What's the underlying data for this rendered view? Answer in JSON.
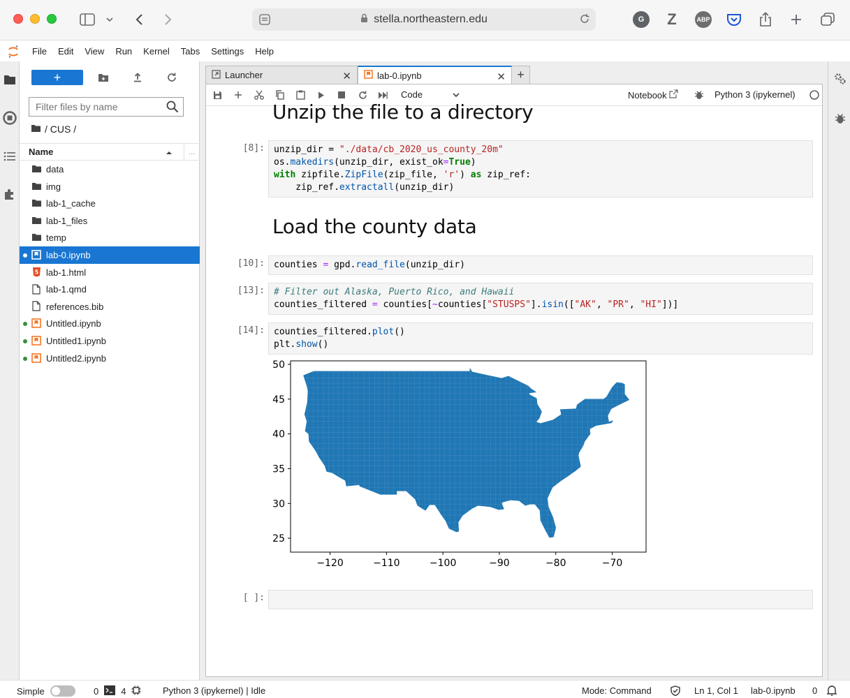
{
  "browser": {
    "url": "stella.northeastern.edu",
    "ext_abp": "ABP"
  },
  "menu": [
    "File",
    "Edit",
    "View",
    "Run",
    "Kernel",
    "Tabs",
    "Settings",
    "Help"
  ],
  "filebrowser": {
    "new_label": "+",
    "filter_placeholder": "Filter files by name",
    "breadcrumb": "/ CUS /",
    "header_name": "Name",
    "header_more": "...",
    "files": [
      {
        "name": "data",
        "type": "folder",
        "dot": ""
      },
      {
        "name": "img",
        "type": "folder",
        "dot": ""
      },
      {
        "name": "lab-1_cache",
        "type": "folder",
        "dot": ""
      },
      {
        "name": "lab-1_files",
        "type": "folder",
        "dot": ""
      },
      {
        "name": "temp",
        "type": "folder",
        "dot": ""
      },
      {
        "name": "lab-0.ipynb",
        "type": "notebook",
        "dot": "white",
        "selected": true
      },
      {
        "name": "lab-1.html",
        "type": "html",
        "dot": ""
      },
      {
        "name": "lab-1.qmd",
        "type": "file",
        "dot": ""
      },
      {
        "name": "references.bib",
        "type": "file",
        "dot": ""
      },
      {
        "name": "Untitled.ipynb",
        "type": "notebook",
        "dot": "green"
      },
      {
        "name": "Untitled1.ipynb",
        "type": "notebook",
        "dot": "green"
      },
      {
        "name": "Untitled2.ipynb",
        "type": "notebook",
        "dot": "green"
      }
    ]
  },
  "tabs": [
    {
      "label": "Launcher",
      "current": false
    },
    {
      "label": "lab-0.ipynb",
      "current": true
    }
  ],
  "toolbar": {
    "cell_type": "Code",
    "notebook_label": "Notebook",
    "kernel": "Python 3 (ipykernel)"
  },
  "notebook": {
    "heading1": "Unzip the file to a directory",
    "heading2": "Load the county data",
    "prompt_8": "[8]:",
    "prompt_10": "[10]:",
    "prompt_13": "[13]:",
    "prompt_14": "[14]:",
    "prompt_empty": "[ ]:",
    "code_8": [
      "unzip_dir = \"./data/cb_2020_us_county_20m\"",
      "os.makedirs(unzip_dir, exist_ok=True)",
      "with zipfile.ZipFile(zip_file, 'r') as zip_ref:",
      "    zip_ref.extractall(unzip_dir)"
    ],
    "code_10": "counties = gpd.read_file(unzip_dir)",
    "code_13": [
      "# Filter out Alaska, Puerto Rico, and Hawaii",
      "counties_filtered = counties[~counties[\"STUSPS\"].isin([\"AK\", \"PR\", \"HI\"])]"
    ],
    "code_14": [
      "counties_filtered.plot()",
      "plt.show()"
    ]
  },
  "chart_data": {
    "type": "map",
    "x_ticks": [
      "−120",
      "−110",
      "−100",
      "−90",
      "−80",
      "−70"
    ],
    "y_ticks": [
      "50",
      "45",
      "40",
      "35",
      "30",
      "25"
    ],
    "xlim": [
      -127,
      -64
    ],
    "ylim": [
      23,
      50.5
    ],
    "fill_color": "#1f77b4"
  },
  "status": {
    "mode_label": "Simple",
    "terminals": "0",
    "kernels": "4",
    "kernel_status": "Python 3 (ipykernel) | Idle",
    "mode": "Mode: Command",
    "position": "Ln 1, Col 1",
    "filename": "lab-0.ipynb",
    "notifications": "0"
  }
}
